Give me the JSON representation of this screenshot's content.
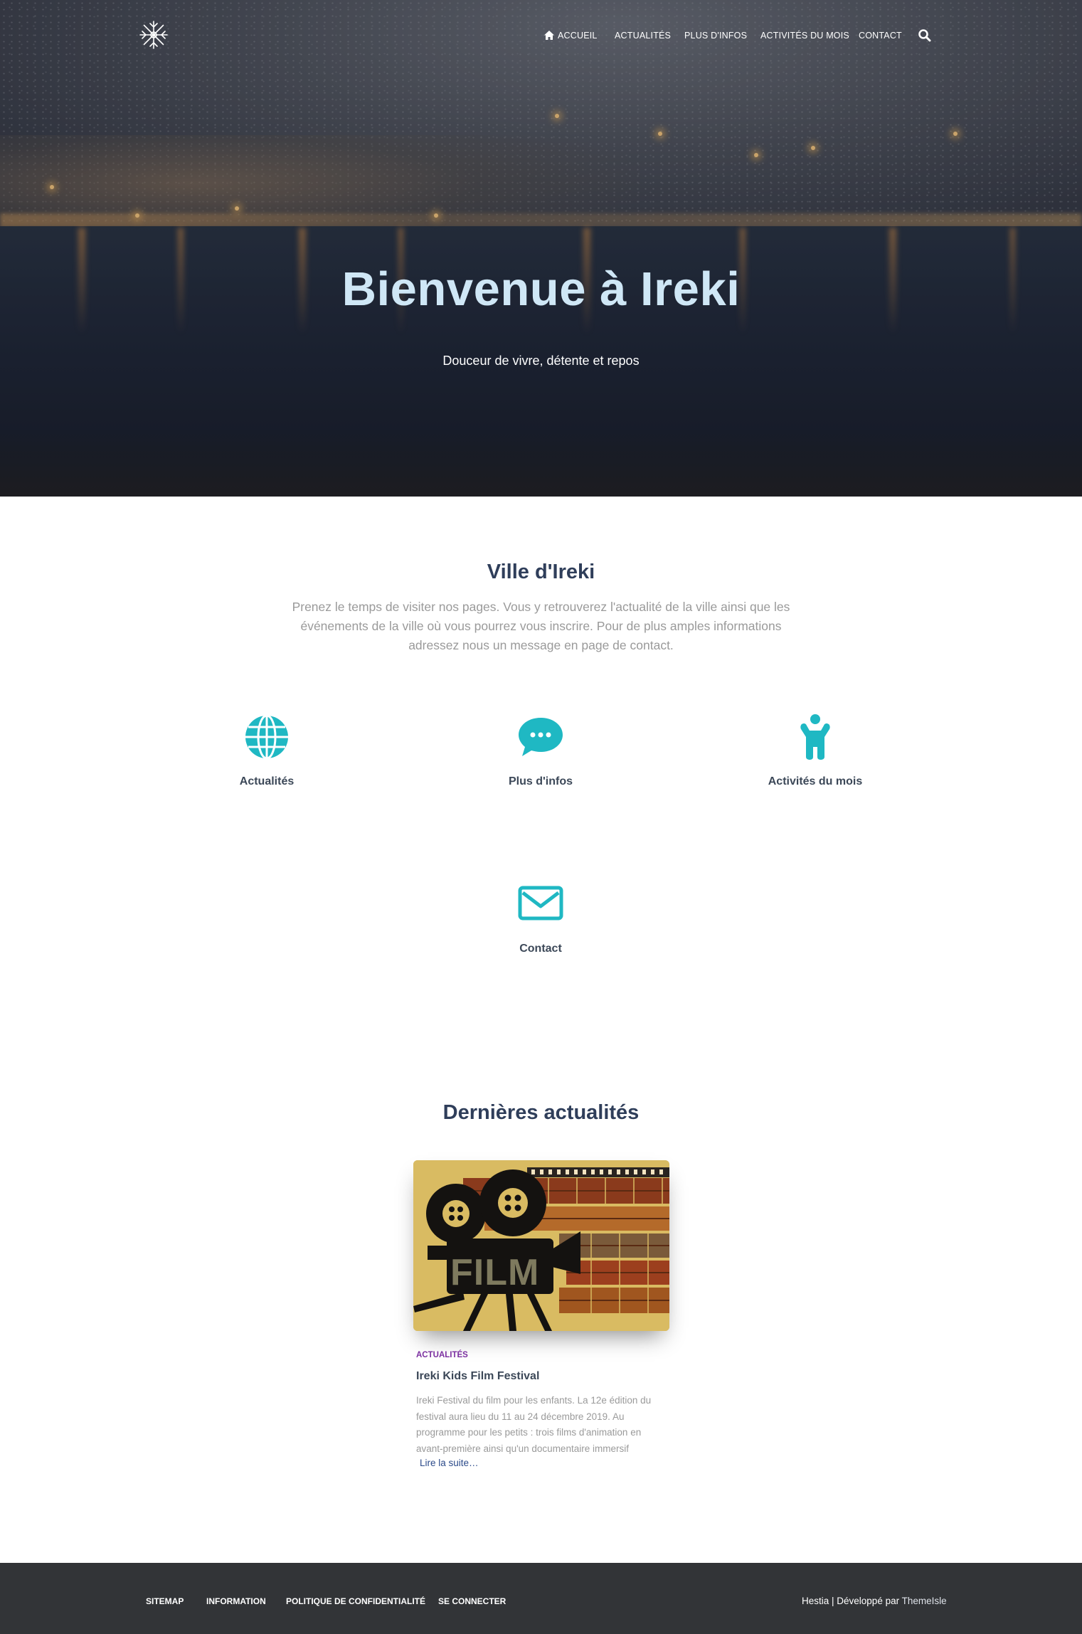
{
  "nav": {
    "items": [
      {
        "label": "Accueil",
        "icon": "home-icon"
      },
      {
        "label": "Actualités"
      },
      {
        "label": "Plus d'infos"
      },
      {
        "label": "Activités du mois"
      },
      {
        "label": "Contact"
      }
    ],
    "search_icon": "search-icon",
    "logo_icon": "snowflake-icon"
  },
  "hero": {
    "title": "Bienvenue à Ireki",
    "subtitle": "Douceur de vivre, détente et repos"
  },
  "about": {
    "title": "Ville d'Ireki",
    "text": "Prenez le temps de visiter nos pages. Vous y retrouverez l'actualité de la ville ainsi que les événements de la ville où vous pourrez vous inscrire. Pour de plus amples informations adressez nous un message en page de contact.",
    "features": [
      {
        "label": "Actualités",
        "icon": "globe-icon"
      },
      {
        "label": "Plus d'infos",
        "icon": "speech-bubble-icon"
      },
      {
        "label": "Activités du mois",
        "icon": "child-icon"
      },
      {
        "label": "Contact",
        "icon": "envelope-icon"
      }
    ],
    "accent_color": "#1fb8c3"
  },
  "news": {
    "title": "Dernières actualités",
    "cards": [
      {
        "category": "Actualités",
        "title": "Ireki Kids Film Festival",
        "excerpt": " Ireki Festival du film pour les enfants. La 12e édition du festival aura lieu du 11 au 24 décembre 2019. Au programme pour les petits : trois films d'animation en avant-première ainsi qu'un documentaire immersif",
        "read_more": "Lire la suite…",
        "image_text": "FILM"
      }
    ]
  },
  "footer": {
    "links": [
      "Sitemap",
      "Information",
      "Politique de confidentialité",
      "Se connecter"
    ],
    "copyright_prefix": "Hestia | Développé par ",
    "copyright_brand": "ThemeIsle"
  }
}
